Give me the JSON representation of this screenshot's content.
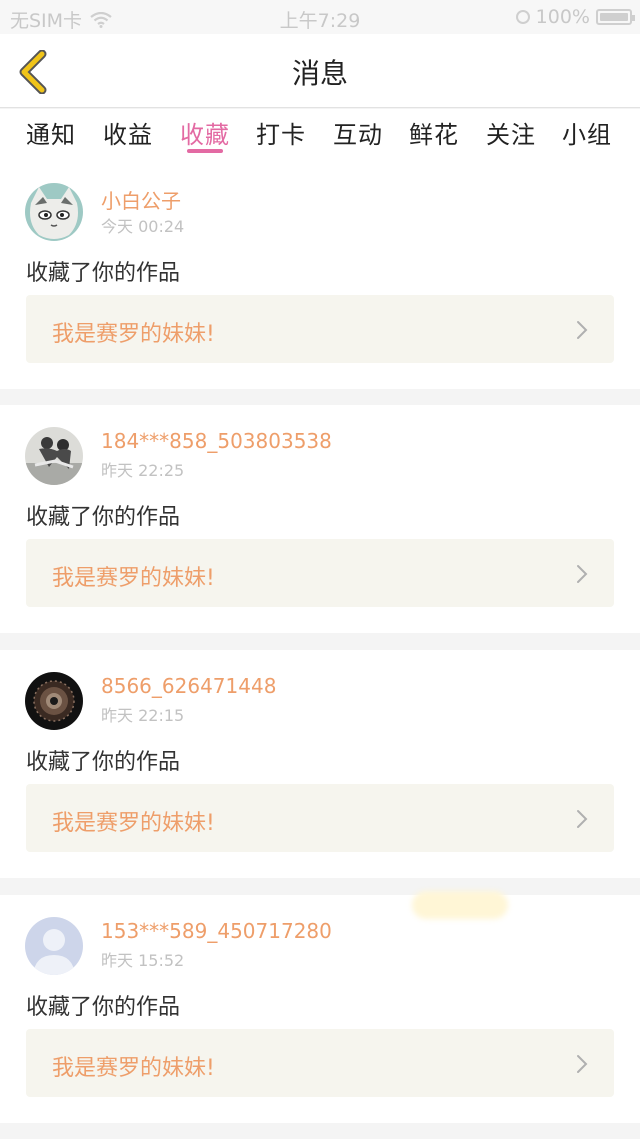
{
  "status_bar": {
    "carrier": "无SIM卡",
    "time": "上午7:29",
    "battery": "100%"
  },
  "nav": {
    "title": "消息"
  },
  "tabs": [
    {
      "label": "通知",
      "active": false
    },
    {
      "label": "收益",
      "active": false
    },
    {
      "label": "收藏",
      "active": true
    },
    {
      "label": "打卡",
      "active": false
    },
    {
      "label": "互动",
      "active": false
    },
    {
      "label": "鲜花",
      "active": false
    },
    {
      "label": "关注",
      "active": false
    },
    {
      "label": "小组",
      "active": false
    }
  ],
  "messages": [
    {
      "username": "小白公子",
      "time": "今天 00:24",
      "action": "收藏了你的作品",
      "work_title": "我是赛罗的妹妹!"
    },
    {
      "username": "184***858_503803538",
      "time": "昨天 22:25",
      "action": "收藏了你的作品",
      "work_title": "我是赛罗的妹妹!"
    },
    {
      "username": "8566_626471448",
      "time": "昨天 22:15",
      "action": "收藏了你的作品",
      "work_title": "我是赛罗的妹妹!"
    },
    {
      "username": "153***589_450717280",
      "time": "昨天 15:52",
      "action": "收藏了你的作品",
      "work_title": "我是赛罗的妹妹!"
    }
  ],
  "colors": {
    "accent": "#e36aa3",
    "username": "#ee9e6a",
    "back_arrow": "#f0c419"
  }
}
